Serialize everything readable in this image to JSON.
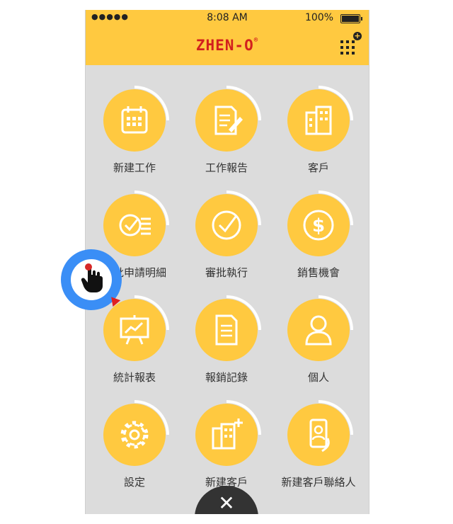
{
  "status_bar": {
    "signal": "●●●●●",
    "time": "8:08 AM",
    "battery": "100%"
  },
  "header": {
    "logo": "ZHEN-O",
    "logo_mark": "®"
  },
  "menu": [
    {
      "label": "新建工作",
      "icon": "calendar-icon"
    },
    {
      "label": "工作報告",
      "icon": "report-edit-icon"
    },
    {
      "label": "客戶",
      "icon": "building-icon"
    },
    {
      "label": "審批申請明細",
      "icon": "check-list-icon"
    },
    {
      "label": "審批執行",
      "icon": "check-circle-icon"
    },
    {
      "label": "銷售機會",
      "icon": "dollar-icon"
    },
    {
      "label": "統計報表",
      "icon": "chart-board-icon"
    },
    {
      "label": "報銷記錄",
      "icon": "document-icon"
    },
    {
      "label": "個人",
      "icon": "person-icon"
    },
    {
      "label": "設定",
      "icon": "gear-icon"
    },
    {
      "label": "新建客戶",
      "icon": "add-building-icon"
    },
    {
      "label": "新建客戶聯絡人",
      "icon": "contact-phone-icon"
    }
  ],
  "fab": {
    "symbol": "✕"
  },
  "colors": {
    "accent": "#ffc940",
    "brand": "#d2201e",
    "background": "#dcdcdc",
    "touch": "#3a8ef6"
  }
}
